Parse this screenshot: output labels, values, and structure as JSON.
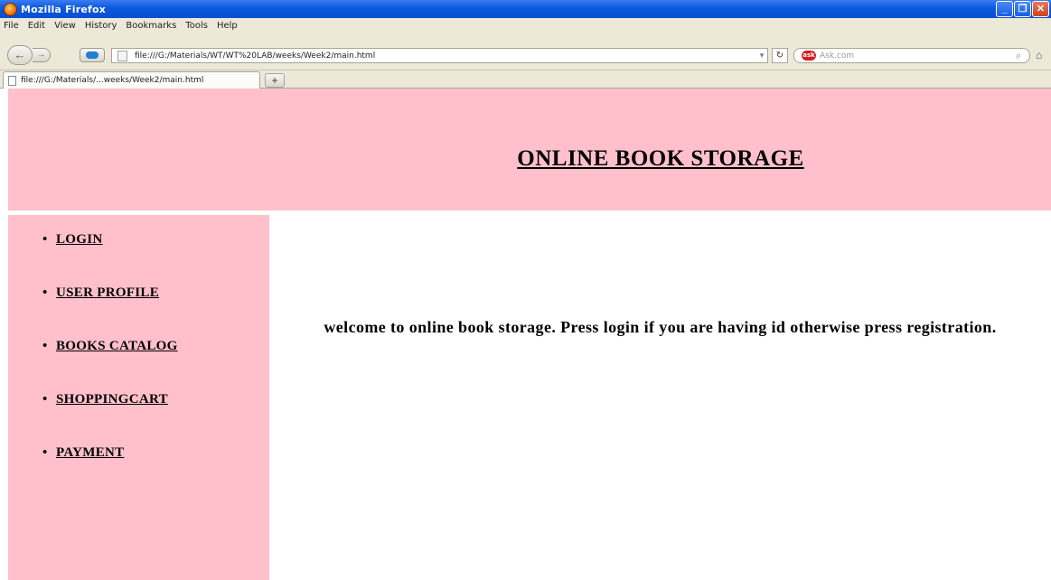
{
  "browser": {
    "title": "Mozilla Firefox",
    "window_buttons": [
      "_",
      "❐",
      "✕"
    ],
    "menu": [
      "File",
      "Edit",
      "View",
      "History",
      "Bookmarks",
      "Tools",
      "Help"
    ],
    "url": "file:///G:/Materials/WT/WT%20LAB/weeks/Week2/main.html",
    "search_placeholder": "Ask.com",
    "search_engine_badge": "ask",
    "tab_title": "file:///G:/Materials/...weeks/Week2/main.html",
    "icons": {
      "back": "back-arrow-icon",
      "forward": "forward-arrow-icon",
      "reload": "reload-icon",
      "search": "magnifier-icon",
      "home": "home-icon",
      "new_tab": "plus-icon"
    }
  },
  "page": {
    "header_title": "ONLINE BOOK STORAGE",
    "nav_links": [
      "LOGIN",
      "USER PROFILE",
      "BOOKS CATALOG",
      "SHOPPINGCART",
      "PAYMENT"
    ],
    "welcome": "welcome to online book storage. Press login if you are having id otherwise press registration.",
    "colors": {
      "frame_background": "#ffc0cb",
      "content_background": "#ffffff"
    }
  }
}
